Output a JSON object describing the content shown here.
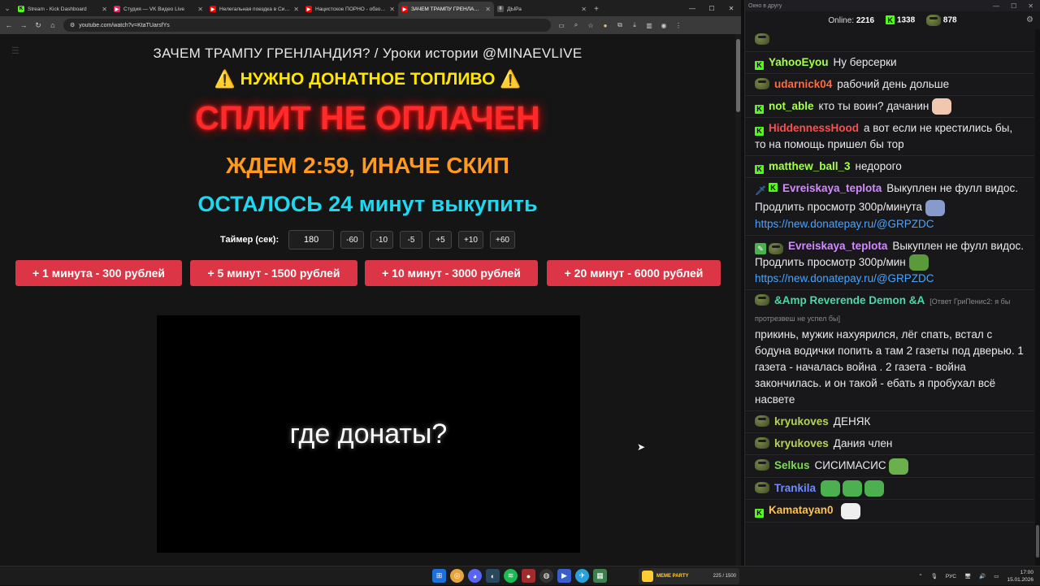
{
  "browser": {
    "tabs": [
      {
        "title": "Stream - Kick Dashboard",
        "fav_color": "#53fc18",
        "fav_glyph": "K",
        "active": false
      },
      {
        "title": "Студия — VK Видео Live",
        "fav_color": "#e0245e",
        "fav_glyph": "▶",
        "active": false
      },
      {
        "title": "Нелегальная поездка в Сирию",
        "fav_color": "#ff0000",
        "fav_glyph": "▶",
        "active": false
      },
      {
        "title": "Нацистское ПОРНО - обзор ви",
        "fav_color": "#ff0000",
        "fav_glyph": "▶",
        "active": false
      },
      {
        "title": "ЗАЧЕМ ТРАМПУ ГРЕНЛАНДИЯ",
        "fav_color": "#ff0000",
        "fav_glyph": "▶",
        "active": true
      },
      {
        "title": "ДЫРа",
        "fav_color": "#555555",
        "fav_glyph": "◊",
        "active": false
      }
    ],
    "url": "youtube.com/watch?v=KtaTUarsfYs"
  },
  "page": {
    "video_title": "ЗАЧЕМ ТРАМПУ ГРЕНЛАНДИЯ? / Уроки истории @MINAEVLIVE",
    "fuel_banner": "⚠️ НУЖНО ДОНАТНОЕ ТОПЛИВО ⚠️",
    "split_banner": "СПЛИТ НЕ ОПЛАЧЕН",
    "wait_banner": "ЖДЕМ 2:59, ИНАЧЕ СКИП",
    "remain_banner": "ОСТАЛОСЬ 24 минут выкупить",
    "timer": {
      "label": "Таймер (сек):",
      "value": "180",
      "buttons": [
        "-60",
        "-10",
        "-5",
        "+5",
        "+10",
        "+60"
      ]
    },
    "donate_buttons": [
      "+ 1 минута - 300 рублей",
      "+ 5 минут - 1500 рублей",
      "+ 10 минут - 3000 рублей",
      "+ 20 минут - 6000 рублей"
    ],
    "video_overlay_text": "где донаты?"
  },
  "chat": {
    "window_title": "Окно в другу",
    "online_label": "Online:",
    "online_count": "2216",
    "kick_count": "1338",
    "other_count": "878",
    "messages": [
      {
        "badge": "frog",
        "nick": "",
        "color": "#53fc18",
        "reply": "",
        "text": "",
        "emote": "",
        "partial": true
      },
      {
        "badge": "kick",
        "nick": "YahooEyou",
        "color": "#a6ff4d",
        "reply": "",
        "text": "Ну берсерки",
        "emote": ""
      },
      {
        "badge": "frog",
        "nick": "udarnick04",
        "color": "#ff6b3d",
        "reply": "",
        "text": "рабочий день дольше",
        "emote": ""
      },
      {
        "badge": "kick",
        "nick": "not_able",
        "color": "#a6ff4d",
        "reply": "",
        "text": "кто ты воин? дачанин",
        "emote": "clown"
      },
      {
        "badge": "kick",
        "nick": "HiddennessHood",
        "color": "#ff4d4d",
        "reply": "",
        "text": "а вот если не крестились бы, то на помощь пришел бы тор",
        "emote": ""
      },
      {
        "badge": "kick",
        "nick": "matthew_ball_3",
        "color": "#a6ff4d",
        "reply": "",
        "text": "недорого",
        "emote": ""
      },
      {
        "badge": "sword-kick",
        "nick": "Evreiskaya_teplota",
        "color": "#d28bff",
        "reply": "",
        "text": "Выкуплен не фулл видос. Продлить просмотр 300р/минута",
        "link": "https://new.donatepay.ru/@GRPZDC",
        "emote": "small"
      },
      {
        "badge": "pencil-frog",
        "nick": "Evreiskaya_teplota",
        "color": "#d28bff",
        "reply": "",
        "text": "Выкуплен не фулл видос. Продлить просмотр 300р/мин",
        "link": "https://new.donatepay.ru/@GRPZDC",
        "emote": "pepe"
      },
      {
        "badge": "frog",
        "nick": "&Amp Reverende Demon &A",
        "color": "#4dd9a6",
        "reply": "[Ответ ГриПенис2: я бы протрезвеш не успел бы]",
        "text": "прикинь, мужик нахуярился, лёг спать, встал с бодуна водички попить а там 2 газеты под дверью. 1 газета - началась война . 2 газета - война закончилась. и он такой - ебать я пробухал всё насвете",
        "emote": ""
      },
      {
        "badge": "frog",
        "nick": "kryukoves",
        "color": "#b4d455",
        "reply": "",
        "text": "ДЕНЯК",
        "emote": ""
      },
      {
        "badge": "frog",
        "nick": "kryukoves",
        "color": "#b4d455",
        "reply": "",
        "text": "Дания член",
        "emote": ""
      },
      {
        "badge": "frog",
        "nick": "Selkus",
        "color": "#7ed957",
        "reply": "",
        "text": "СИСИМАСИС",
        "emote": "pepe-face"
      },
      {
        "badge": "frog",
        "nick": "Trankila",
        "color": "#6e8bff",
        "reply": "",
        "text": "",
        "emote": "pepe-triple"
      },
      {
        "badge": "kick",
        "nick": "Kamatayan0",
        "color": "#ffc14d",
        "reply": "",
        "text": "",
        "emote": "clown-face"
      }
    ]
  },
  "taskbar": {
    "widget_label": "MEME PARTY",
    "widget_counter": "225 / 1500",
    "tray_lang": "РУС",
    "time": "17:00",
    "date": "15.01.2026"
  },
  "colors": {
    "kick_green": "#53fc18",
    "donate_red": "#dc3545",
    "split_red": "#ff2a2a",
    "fuel_yellow": "#ffe600",
    "wait_orange": "#ff9a1f",
    "remain_cyan": "#1ed8f0"
  }
}
